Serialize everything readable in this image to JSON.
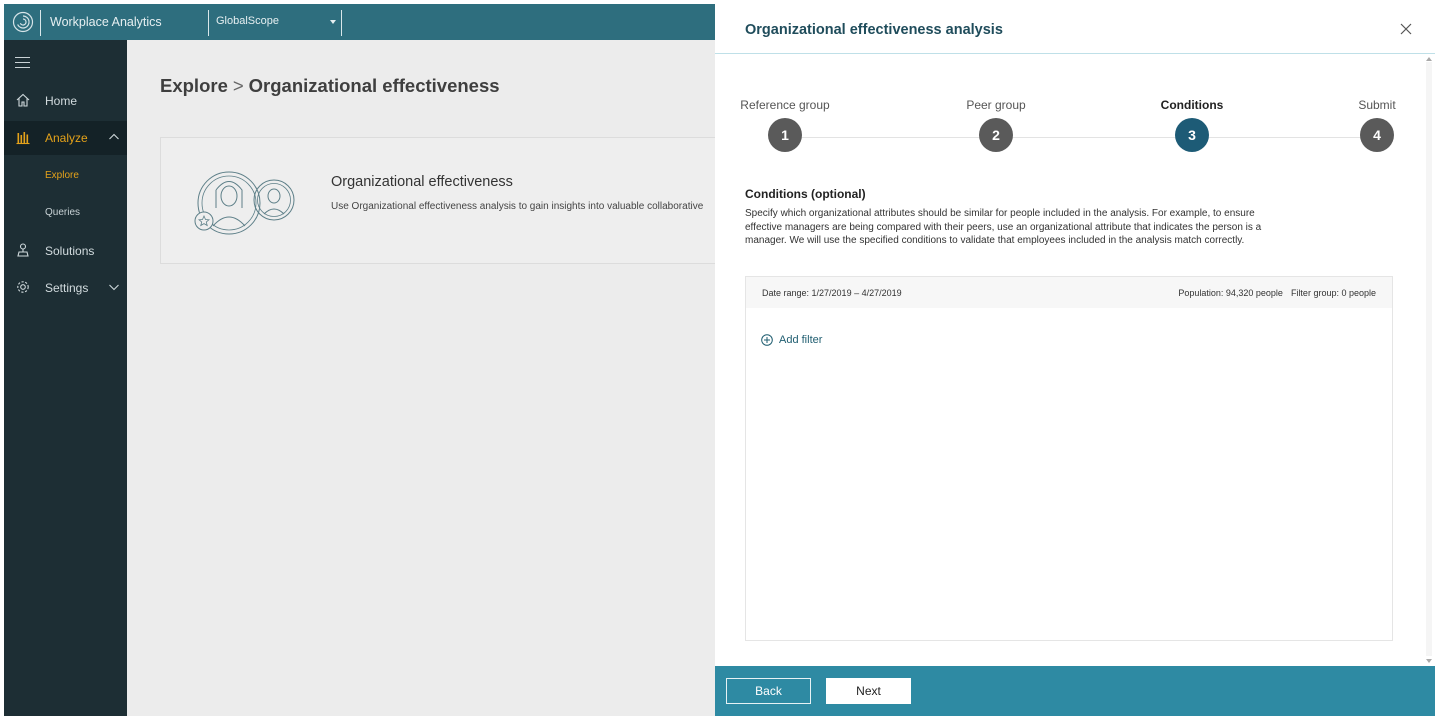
{
  "topbar": {
    "app_title": "Workplace Analytics",
    "scope": "GlobalScope"
  },
  "sidebar": {
    "items": [
      {
        "label": "Home",
        "icon": "home-icon"
      },
      {
        "label": "Analyze",
        "icon": "analyze-icon"
      },
      {
        "label": "Solutions",
        "icon": "solutions-icon"
      },
      {
        "label": "Settings",
        "icon": "gear-icon"
      }
    ],
    "subitems": [
      {
        "label": "Explore"
      },
      {
        "label": "Queries"
      }
    ]
  },
  "main": {
    "breadcrumb": {
      "root": "Explore",
      "sep": ">",
      "current": "Organizational effectiveness"
    },
    "card": {
      "title": "Organizational effectiveness",
      "description": "Use Organizational effectiveness analysis to gain insights into valuable collaborative"
    }
  },
  "panel": {
    "title": "Organizational effectiveness analysis",
    "steps": [
      {
        "label": "Reference group",
        "number": "1"
      },
      {
        "label": "Peer group",
        "number": "2"
      },
      {
        "label": "Conditions",
        "number": "3"
      },
      {
        "label": "Submit",
        "number": "4"
      }
    ],
    "conditions": {
      "title": "Conditions (optional)",
      "description": "Specify which organizational attributes should be similar for people included in the analysis. For example, to ensure effective managers are being compared with their peers, use an organizational attribute that indicates the person is a manager. We will use the specified conditions to validate that employees included in the analysis match correctly."
    },
    "filter": {
      "date_range": "Date range:  1/27/2019 – 4/27/2019",
      "population": "Population: 94,320 people",
      "filter_group": "Filter group: 0 people",
      "add_filter": "Add filter"
    },
    "footer": {
      "back": "Back",
      "next": "Next"
    }
  },
  "colors": {
    "topbar": "#2e6e7e",
    "sidebar": "#1d2e34",
    "accent": "#e4a21a",
    "footer": "#2e8aa3",
    "active_step": "#1d5b76"
  }
}
